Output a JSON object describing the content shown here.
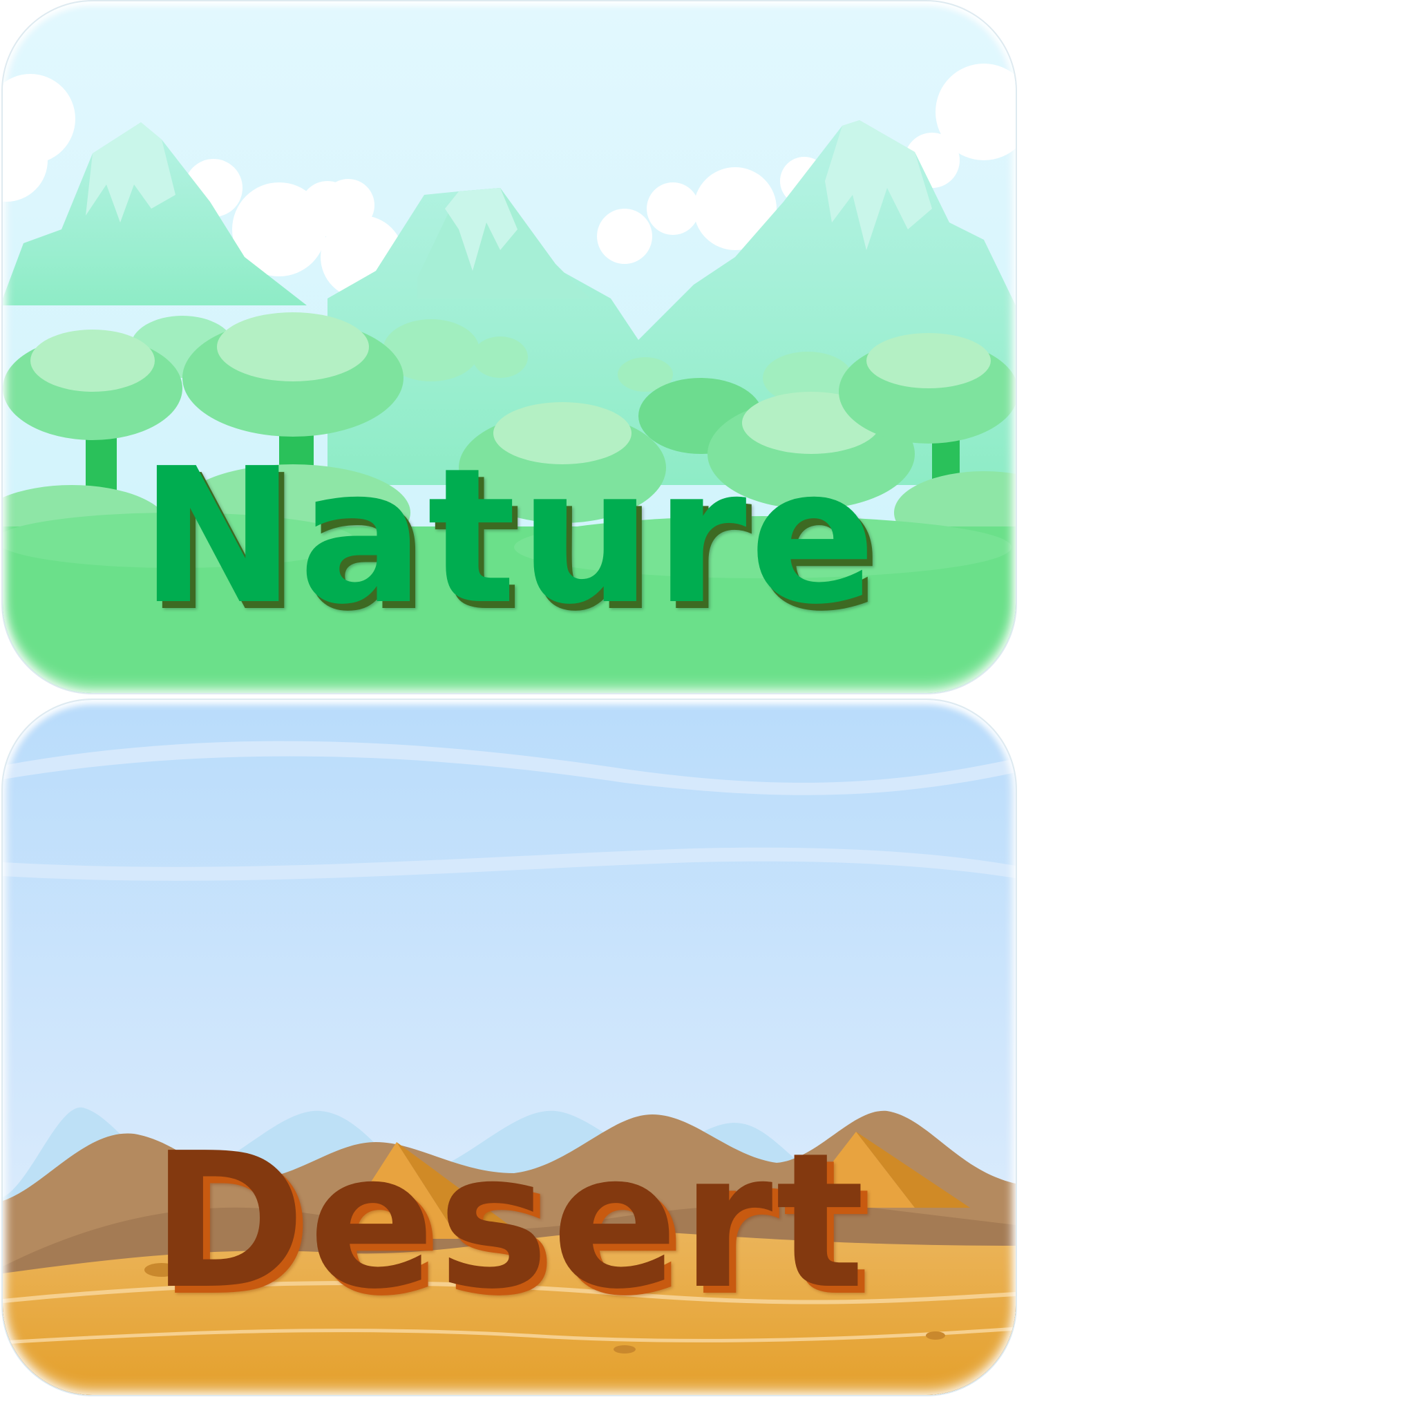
{
  "cards": [
    {
      "label": "Nature",
      "sky_color": "#dff7fd",
      "ground_color": "#6be08a",
      "text_color": "#00ad50"
    },
    {
      "label": "Desert",
      "sky_color": "#c0dffb",
      "ground_color": "#e7a53a",
      "text_color": "#83390f"
    }
  ]
}
